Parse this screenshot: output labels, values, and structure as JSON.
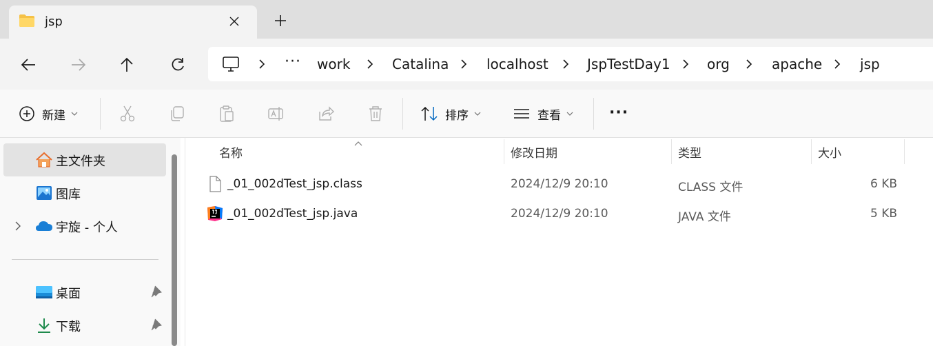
{
  "tab": {
    "title": "jsp",
    "close_label": "✕",
    "new_tab_label": "+"
  },
  "nav": {
    "back_icon": "arrow-left-icon",
    "forward_icon": "arrow-right-icon",
    "up_icon": "arrow-up-icon",
    "refresh_icon": "refresh-icon"
  },
  "breadcrumb": {
    "overflow": "···",
    "items": [
      "work",
      "Catalina",
      "localhost",
      "JspTestDay1",
      "org",
      "apache",
      "jsp"
    ]
  },
  "commands": {
    "new_label": "新建",
    "sort_label": "排序",
    "view_label": "查看",
    "more_label": "···"
  },
  "sidebar": {
    "items": [
      {
        "label": "主文件夹",
        "icon": "home-icon"
      },
      {
        "label": "图库",
        "icon": "gallery-icon"
      },
      {
        "label": "宇旋 - 个人",
        "icon": "cloud-icon"
      },
      {
        "label": "桌面",
        "icon": "desktop-icon"
      },
      {
        "label": "下载",
        "icon": "download-icon"
      }
    ]
  },
  "columns": {
    "name": "名称",
    "modified": "修改日期",
    "type": "类型",
    "size": "大小"
  },
  "files": [
    {
      "name": "_01_002dTest_jsp.class",
      "modified": "2024/12/9 20:10",
      "type": "CLASS 文件",
      "size": "6 KB",
      "icon": "file-icon"
    },
    {
      "name": "_01_002dTest_jsp.java",
      "modified": "2024/12/9 20:10",
      "type": "JAVA 文件",
      "size": "5 KB",
      "icon": "intellij-icon"
    }
  ],
  "colors": {
    "accent": "#0067c0",
    "folder": "#f5c146",
    "selected": "#e3e3e3"
  }
}
